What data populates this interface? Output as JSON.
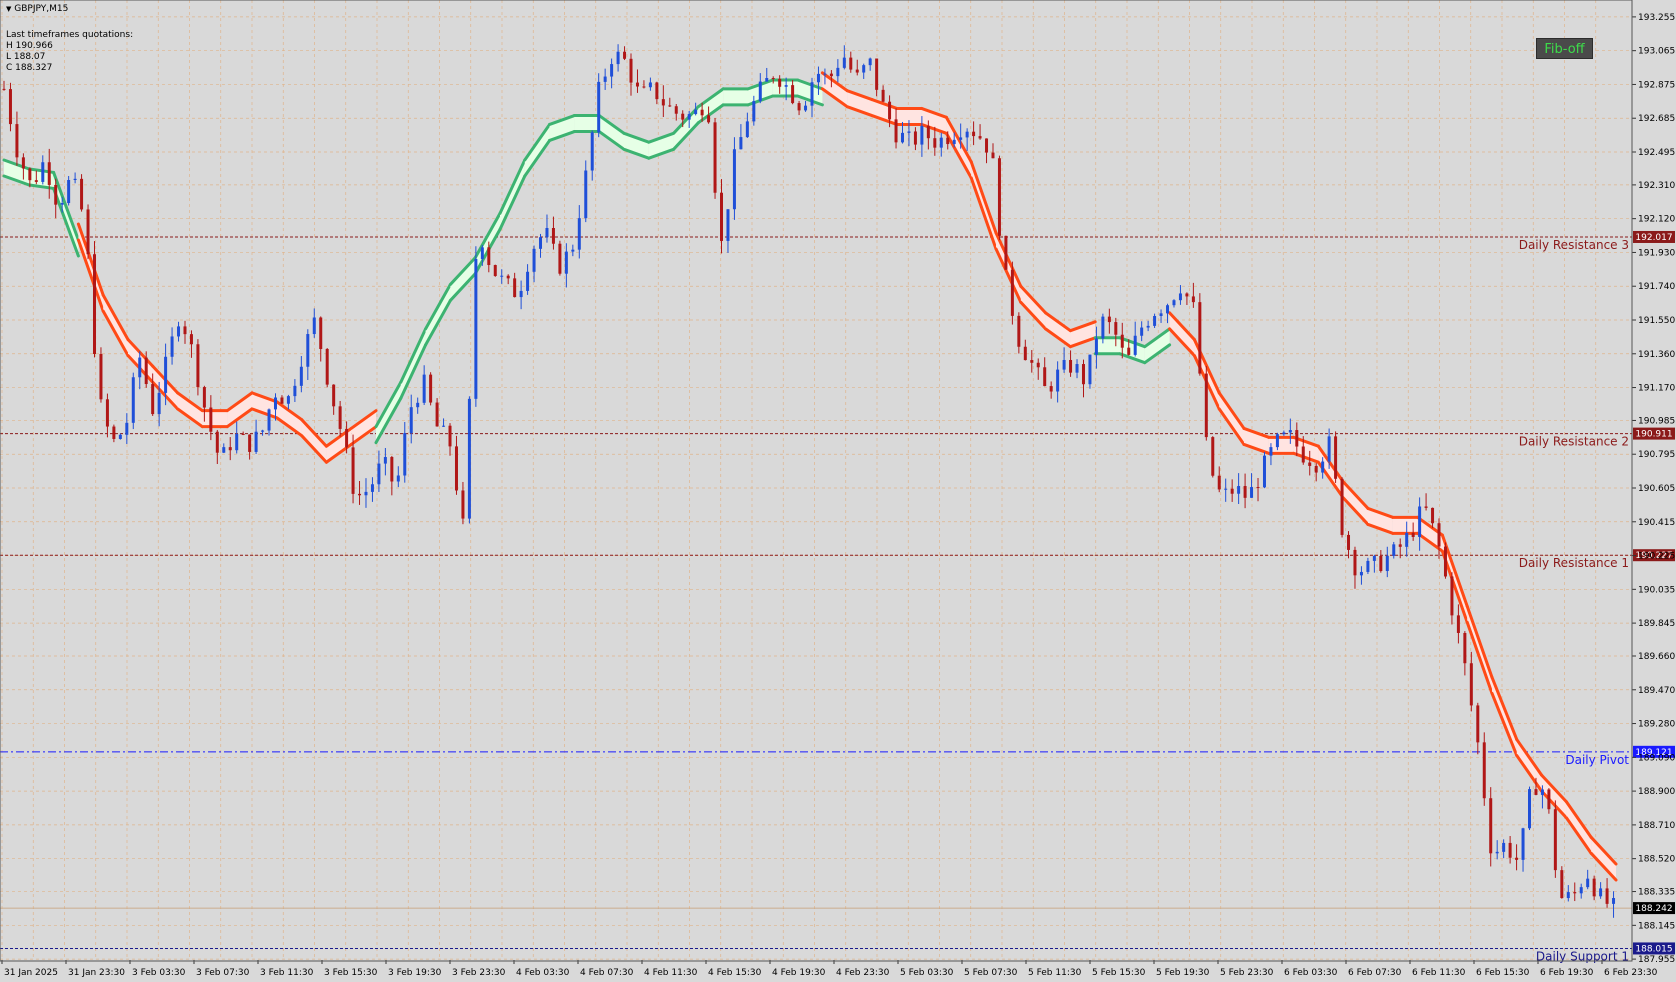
{
  "window": {
    "symbol_title": "GBPJPY,M15",
    "info_heading": "Last timeframes quotations:",
    "info_high": "H 190.966",
    "info_low": "L 188.07",
    "info_close": "C 188.327",
    "fib_button_label": "Fib-off",
    "menu_arrow_icon": "triangle-down-icon"
  },
  "colors": {
    "background": "#d9d9d9",
    "grid": "#e0b48a",
    "bull_candle": "#1f4fd8",
    "bear_candle": "#b01717",
    "ma_bear": "#ff4a16",
    "ma_bull": "#3cb371",
    "ma_bear_fill": "#ffe4e1",
    "ma_bull_fill": "#e6ffe6",
    "resistance": "#8b1a1a",
    "pivot": "#1a1aff",
    "support": "#1a1a8b"
  },
  "chart_data": {
    "type": "candlestick",
    "ylim": [
      187.95,
      193.35
    ],
    "y_ticks": [
      "193.255",
      "193.065",
      "192.875",
      "192.685",
      "192.495",
      "192.310",
      "192.120",
      "191.930",
      "191.740",
      "191.550",
      "191.360",
      "191.170",
      "190.985",
      "190.795",
      "190.605",
      "190.415",
      "190.225",
      "190.035",
      "189.845",
      "189.660",
      "189.470",
      "189.280",
      "189.090",
      "188.900",
      "188.710",
      "188.520",
      "188.335",
      "188.145",
      "187.955"
    ],
    "x_ticks": [
      "31 Jan 2025",
      "31 Jan 23:30",
      "3 Feb 03:30",
      "3 Feb 07:30",
      "3 Feb 11:30",
      "3 Feb 15:30",
      "3 Feb 19:30",
      "3 Feb 23:30",
      "4 Feb 03:30",
      "4 Feb 07:30",
      "4 Feb 11:30",
      "4 Feb 15:30",
      "4 Feb 19:30",
      "4 Feb 23:30",
      "5 Feb 03:30",
      "5 Feb 07:30",
      "5 Feb 11:30",
      "5 Feb 15:30",
      "5 Feb 19:30",
      "5 Feb 23:30",
      "6 Feb 03:30",
      "6 Feb 07:30",
      "6 Feb 11:30",
      "6 Feb 15:30",
      "6 Feb 19:30",
      "6 Feb 23:30"
    ],
    "current_price": "188.242",
    "levels": [
      {
        "name": "Daily Resistance 3",
        "price": 192.017,
        "label": "192.017",
        "style": "dashed",
        "color": "#8b1a1a"
      },
      {
        "name": "Daily Resistance 2",
        "price": 190.911,
        "label": "190.911",
        "style": "dashed",
        "color": "#8b1a1a"
      },
      {
        "name": "Daily Resistance 1",
        "price": 190.227,
        "label": "190.227",
        "style": "dashed",
        "color": "#8b1a1a"
      },
      {
        "name": "Daily Pivot",
        "price": 189.121,
        "label": "189.121",
        "style": "dashdot",
        "color": "#1a1aff"
      },
      {
        "name": "Daily Support 1",
        "price": 188.015,
        "label": "188.015",
        "style": "dashed",
        "color": "#1a1a8b"
      }
    ],
    "price_path": [
      192.85,
      192.5,
      192.3,
      192.45,
      192.2,
      192.35,
      192.1,
      191.1,
      190.85,
      190.95,
      191.35,
      191.05,
      191.3,
      191.6,
      191.35,
      191.0,
      190.75,
      190.9,
      190.85,
      190.9,
      191.15,
      191.1,
      191.35,
      191.55,
      191.2,
      190.9,
      190.55,
      190.6,
      190.75,
      190.6,
      191.05,
      191.2,
      190.95,
      190.85,
      190.35,
      192.1,
      191.85,
      191.75,
      191.7,
      191.95,
      192.05,
      191.85,
      191.95,
      192.35,
      192.85,
      193.05,
      193.0,
      192.8,
      192.85,
      192.75,
      192.7,
      192.7,
      192.8,
      191.95,
      192.45,
      192.7,
      192.85,
      192.95,
      192.85,
      192.75,
      192.95,
      192.9,
      193.05,
      192.9,
      193.0,
      192.75,
      192.6,
      192.55,
      192.6,
      192.55,
      192.6,
      192.65,
      192.6,
      192.5,
      191.8,
      191.45,
      191.3,
      191.15,
      191.25,
      191.3,
      191.2,
      191.55,
      191.5,
      191.3,
      191.5,
      191.6,
      191.65,
      191.75,
      191.6,
      190.75,
      190.55,
      190.6,
      190.55,
      190.7,
      190.85,
      190.9,
      190.8,
      190.75,
      190.85,
      190.35,
      190.15,
      190.15,
      190.2,
      190.25,
      190.35,
      190.5,
      190.3,
      189.95,
      189.6,
      189.15,
      188.55,
      188.6,
      188.5,
      188.95,
      188.9,
      188.3,
      188.3,
      188.45,
      188.3,
      188.24
    ],
    "ma_path": [
      192.45,
      192.4,
      192.38,
      192.0,
      191.6,
      191.35,
      191.2,
      191.05,
      190.95,
      190.95,
      191.05,
      191.0,
      190.9,
      190.75,
      190.85,
      190.95,
      191.2,
      191.5,
      191.75,
      191.9,
      192.15,
      192.45,
      192.65,
      192.7,
      192.7,
      192.6,
      192.55,
      192.6,
      192.75,
      192.85,
      192.85,
      192.9,
      192.9,
      192.85,
      192.75,
      192.7,
      192.65,
      192.65,
      192.6,
      192.35,
      191.95,
      191.65,
      191.5,
      191.4,
      191.45,
      191.45,
      191.4,
      191.5,
      191.35,
      191.05,
      190.85,
      190.8,
      190.8,
      190.75,
      190.55,
      190.4,
      190.35,
      190.35,
      190.25,
      189.85,
      189.45,
      189.1,
      188.9,
      188.75,
      188.55,
      188.4
    ],
    "ma_colors": [
      "bull",
      "bull",
      "bull",
      "bear",
      "bear",
      "bear",
      "bear",
      "bear",
      "bear",
      "bear",
      "bear",
      "bear",
      "bear",
      "bear",
      "bear",
      "bull",
      "bull",
      "bull",
      "bull",
      "bull",
      "bull",
      "bull",
      "bull",
      "bull",
      "bull",
      "bull",
      "bull",
      "bull",
      "bull",
      "bull",
      "bull",
      "bull",
      "bull",
      "bear",
      "bear",
      "bear",
      "bear",
      "bear",
      "bear",
      "bear",
      "bear",
      "bear",
      "bear",
      "bear",
      "bull",
      "bull",
      "bull",
      "bear",
      "bear",
      "bear",
      "bear",
      "bear",
      "bear",
      "bear",
      "bear",
      "bear",
      "bear",
      "bear",
      "bear",
      "bear",
      "bear",
      "bear",
      "bear",
      "bear",
      "bear",
      "bear"
    ]
  }
}
